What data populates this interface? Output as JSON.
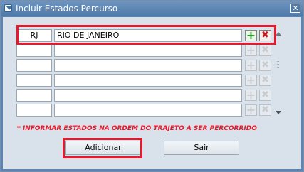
{
  "window": {
    "title": "Incluir Estados Percurso",
    "close_glyph": "✕"
  },
  "rows": [
    {
      "uf": "RJ",
      "name": "RIO DE JANEIRO",
      "active": true
    },
    {
      "uf": "",
      "name": "",
      "active": false
    },
    {
      "uf": "",
      "name": "",
      "active": false
    },
    {
      "uf": "",
      "name": "",
      "active": false
    },
    {
      "uf": "",
      "name": "",
      "active": false
    },
    {
      "uf": "",
      "name": "",
      "active": false
    }
  ],
  "icons": {
    "add": "plus-icon",
    "remove": "x-icon"
  },
  "notice": "* INFORMAR ESTADOS NA ORDEM DO TRAJETO A SER PERCORRIDO",
  "buttons": {
    "add_label": "Adicionar",
    "exit_label": "Sair"
  },
  "colors": {
    "highlight": "#e8192c",
    "add_icon": "#28a028",
    "remove_icon": "#c8181e",
    "titlebar": "#5b84b1"
  }
}
